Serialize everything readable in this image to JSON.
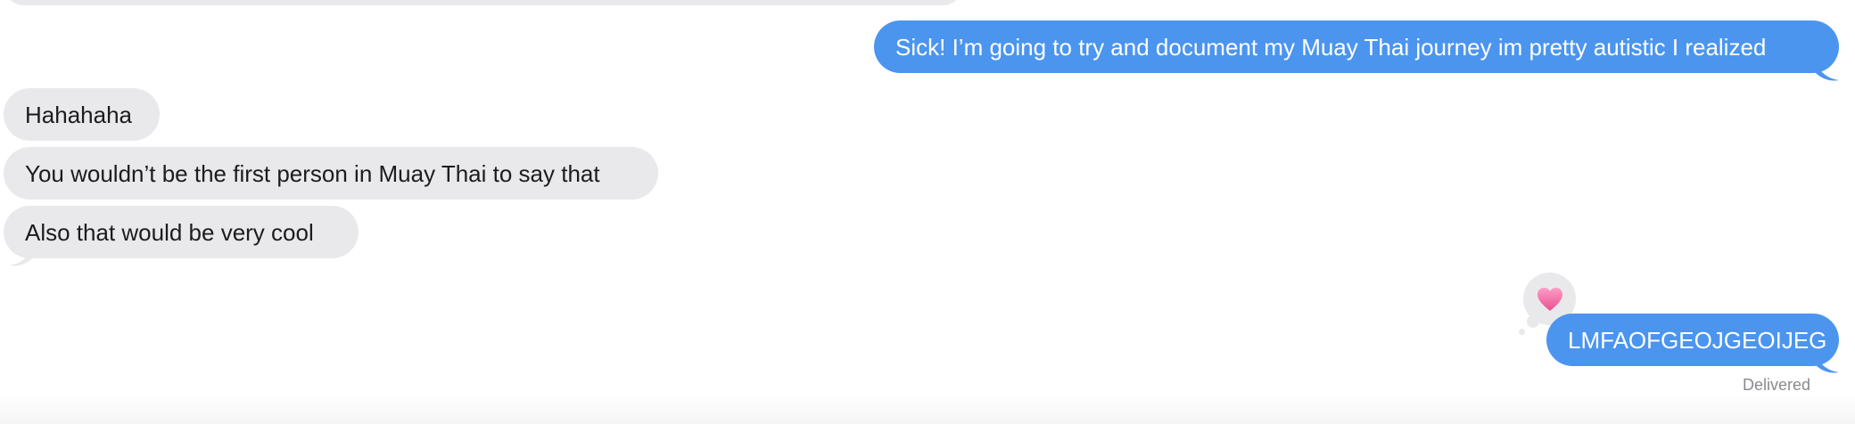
{
  "conversation": {
    "messages": [
      {
        "direction": "outgoing",
        "text": "Sick! I’m going to try and document my Muay Thai journey im pretty autistic I realized"
      },
      {
        "direction": "incoming",
        "text": "Hahahaha"
      },
      {
        "direction": "incoming",
        "text": "You wouldn’t be the first person in Muay Thai to say that"
      },
      {
        "direction": "incoming",
        "text": "Also that would be very cool"
      },
      {
        "direction": "outgoing",
        "text": "LMFAOFGEOJGEOIJEG",
        "reaction": "heart-icon"
      }
    ],
    "status": "Delivered"
  },
  "colors": {
    "outgoing_bubble": "#4b95ef",
    "incoming_bubble": "#e9e9eb",
    "reaction_heart": "#f06fa3"
  }
}
